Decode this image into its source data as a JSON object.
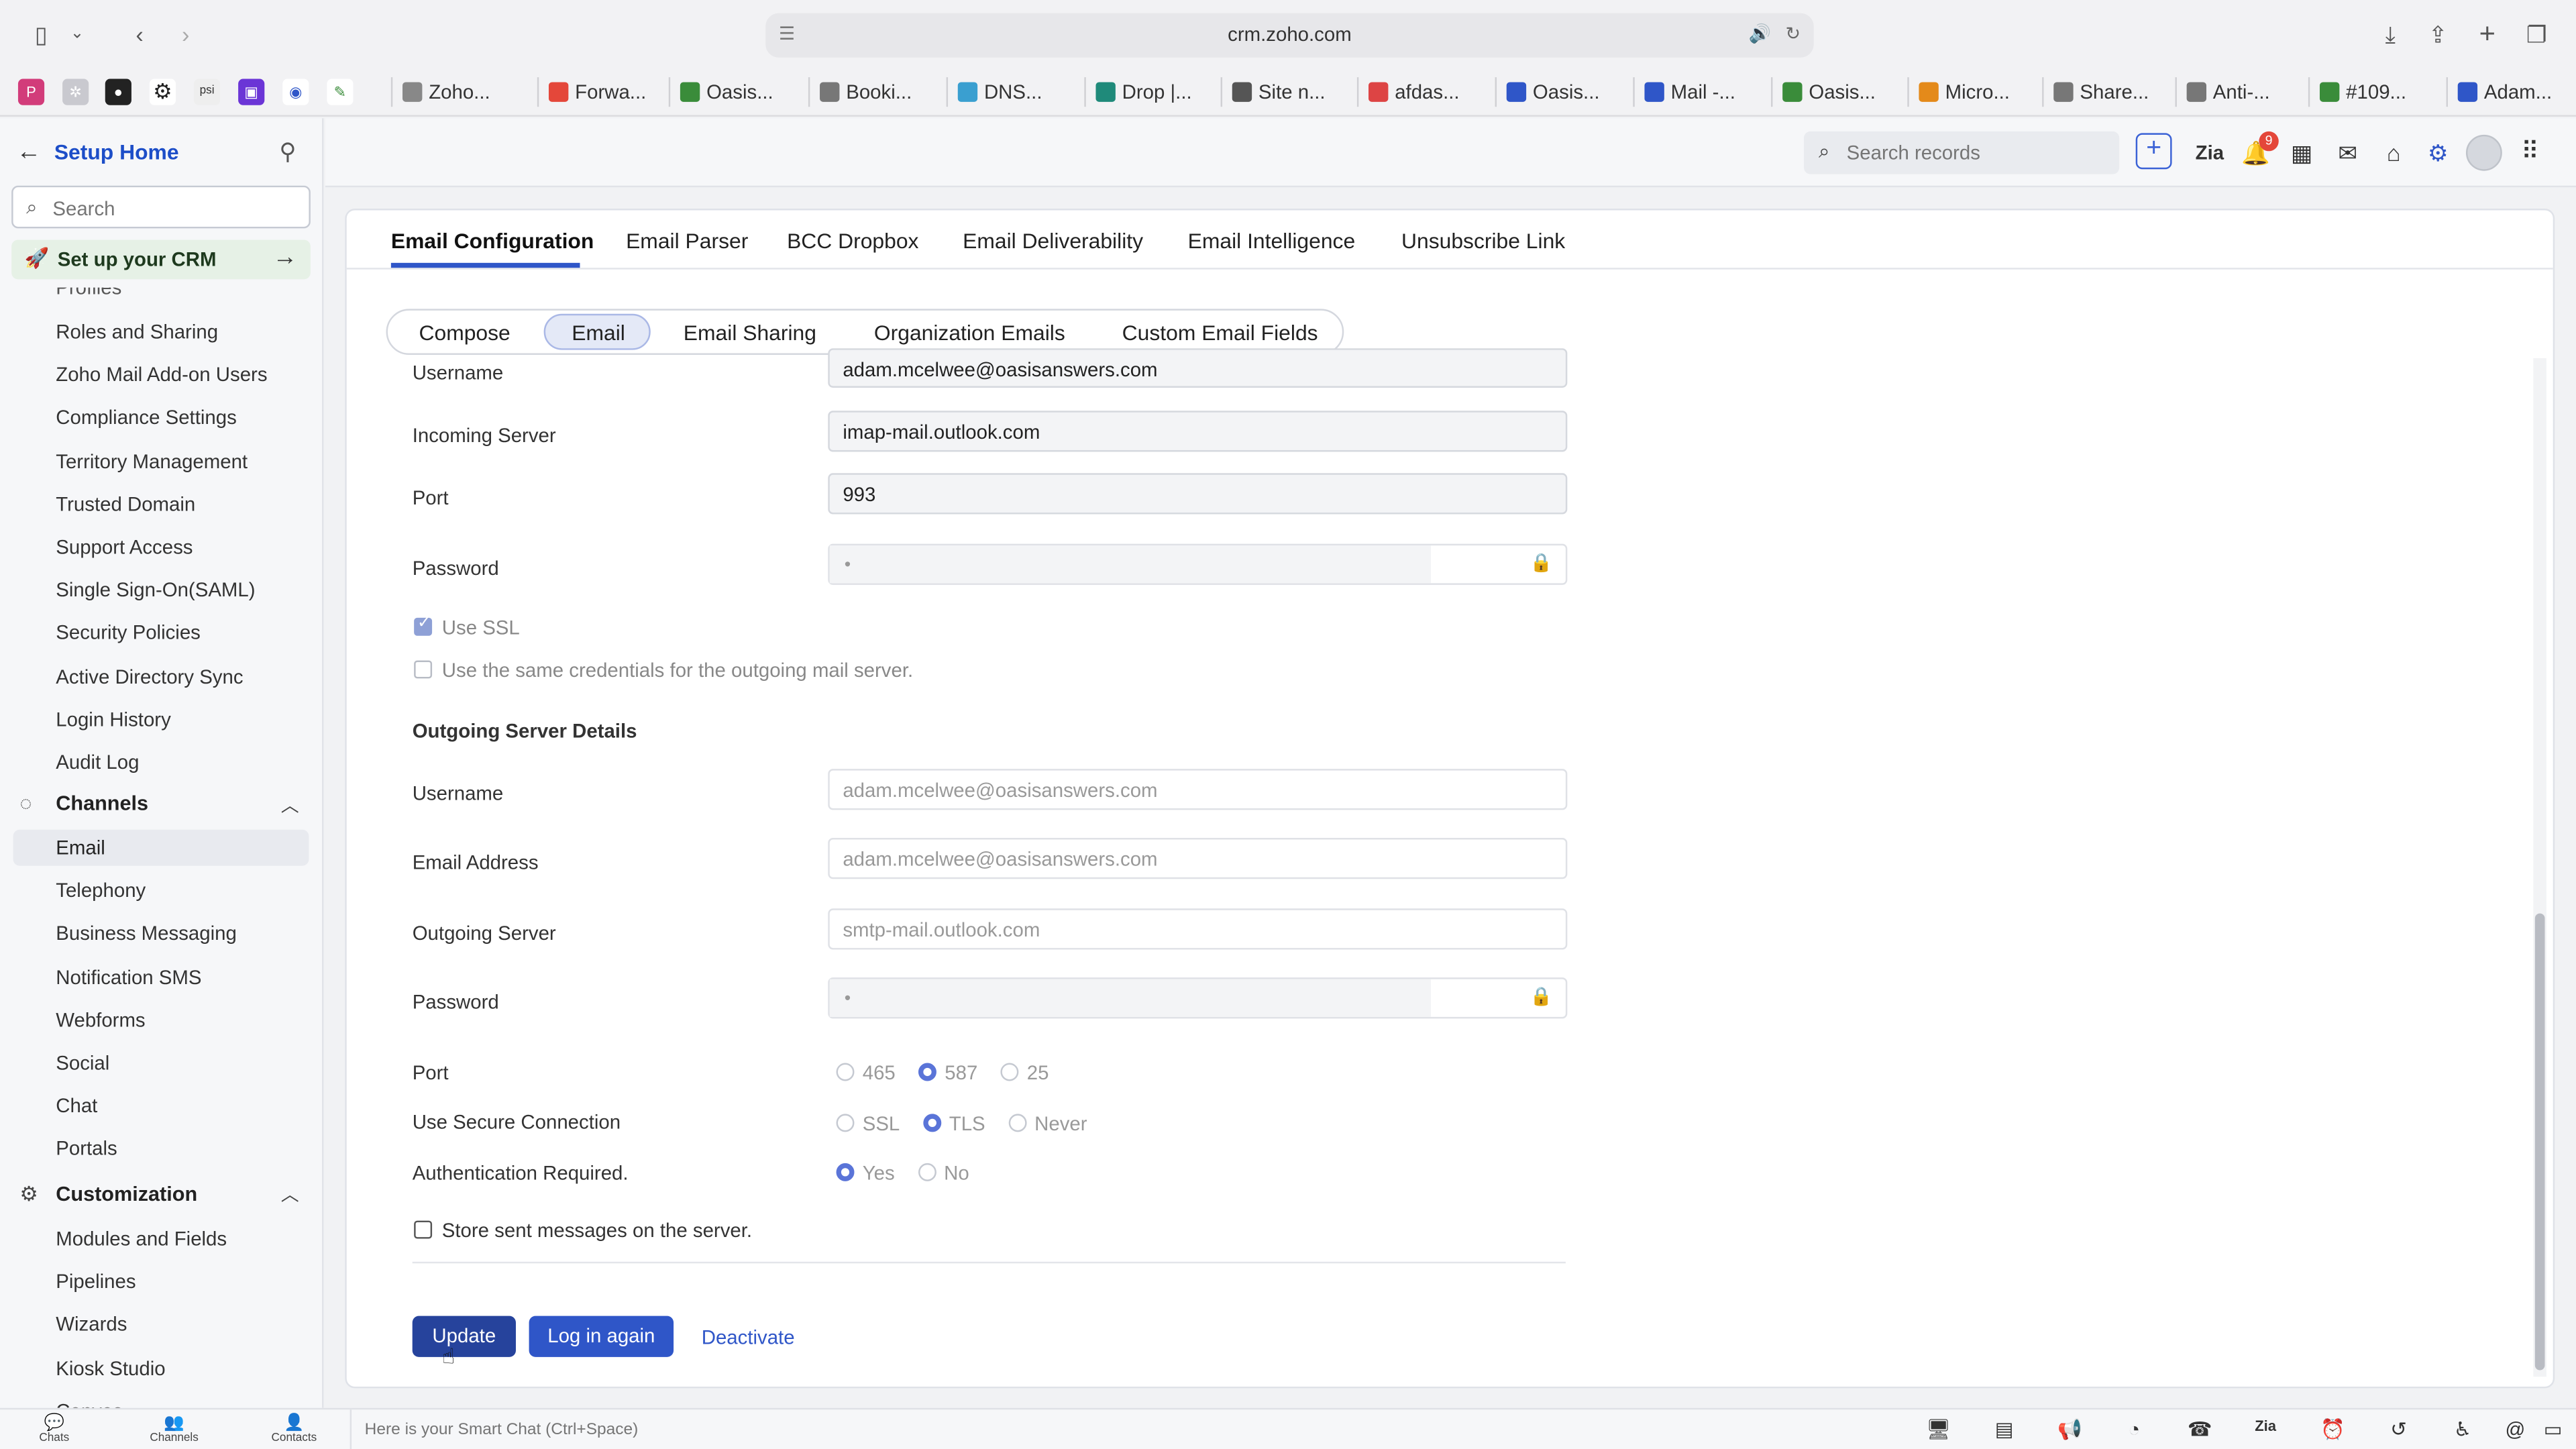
{
  "browser": {
    "url": "crm.zoho.com",
    "bookmarks": [
      {
        "label": "Zoho...",
        "color": "#888"
      },
      {
        "label": "Forwa...",
        "color": "#e4473a"
      },
      {
        "label": "Oasis...",
        "color": "#3a8c3a"
      },
      {
        "label": "Booki...",
        "color": "#777"
      },
      {
        "label": "DNS...",
        "color": "#3a9fd0"
      },
      {
        "label": "Drop |...",
        "color": "#1f8a7a"
      },
      {
        "label": "Site n...",
        "color": "#555"
      },
      {
        "label": "afdas...",
        "color": "#d44"
      },
      {
        "label": "Oasis...",
        "color": "#2f56c8"
      },
      {
        "label": "Mail -...",
        "color": "#2f56c8"
      },
      {
        "label": "Oasis...",
        "color": "#3a8c3a"
      },
      {
        "label": "Micro...",
        "color": "#e48a1a"
      },
      {
        "label": "Share...",
        "color": "#777"
      },
      {
        "label": "Anti-...",
        "color": "#777"
      },
      {
        "label": "#109...",
        "color": "#3a8c3a"
      },
      {
        "label": "Adam...",
        "color": "#2f56c8"
      }
    ]
  },
  "sidebar": {
    "title": "Setup Home",
    "search_placeholder": "Search",
    "crm_setup": "Set up your CRM",
    "cut_item": "Profiles",
    "items_a": [
      "Roles and Sharing",
      "Zoho Mail Add-on Users",
      "Compliance Settings",
      "Territory Management",
      "Trusted Domain",
      "Support Access",
      "Single Sign-On(SAML)",
      "Security Policies",
      "Active Directory Sync",
      "Login History",
      "Audit Log"
    ],
    "section_channels": "Channels",
    "channels": [
      "Email",
      "Telephony",
      "Business Messaging",
      "Notification SMS",
      "Webforms",
      "Social",
      "Chat",
      "Portals"
    ],
    "section_customization": "Customization",
    "customization": [
      "Modules and Fields",
      "Pipelines",
      "Wizards",
      "Kiosk Studio",
      "Canvas"
    ]
  },
  "topbar": {
    "search_placeholder": "Search records",
    "notifications_count": "9"
  },
  "main_tabs": [
    "Email Configuration",
    "Email Parser",
    "BCC Dropbox",
    "Email Deliverability",
    "Email Intelligence",
    "Unsubscribe Link"
  ],
  "sub_tabs": [
    "Compose",
    "Email",
    "Email Sharing",
    "Organization Emails",
    "Custom Email Fields"
  ],
  "incoming": {
    "username_label": "Username",
    "username": "adam.mcelwee@oasisanswers.com",
    "server_label": "Incoming Server",
    "server": "imap-mail.outlook.com",
    "port_label": "Port",
    "port": "993",
    "password_label": "Password",
    "password_mask": "•",
    "use_ssl": "Use SSL",
    "same_credentials": "Use the same credentials for the outgoing mail server."
  },
  "outgoing": {
    "heading": "Outgoing Server Details",
    "username_label": "Username",
    "username": "adam.mcelwee@oasisanswers.com",
    "email_label": "Email Address",
    "email": "adam.mcelwee@oasisanswers.com",
    "server_label": "Outgoing Server",
    "server": "smtp-mail.outlook.com",
    "password_label": "Password",
    "password_mask": "•",
    "port_label": "Port",
    "port_options": [
      "465",
      "587",
      "25"
    ],
    "port_selected": "587",
    "secure_label": "Use Secure Connection",
    "secure_options": [
      "SSL",
      "TLS",
      "Never"
    ],
    "secure_selected": "TLS",
    "auth_label": "Authentication Required.",
    "auth_options": [
      "Yes",
      "No"
    ],
    "auth_selected": "Yes",
    "store_sent": "Store sent messages on the server."
  },
  "actions": {
    "update": "Update",
    "login_again": "Log in again",
    "deactivate": "Deactivate"
  },
  "bottombar": {
    "chats": "Chats",
    "channels": "Channels",
    "contacts": "Contacts",
    "smart_chat_placeholder": "Here is your Smart Chat (Ctrl+Space)"
  }
}
